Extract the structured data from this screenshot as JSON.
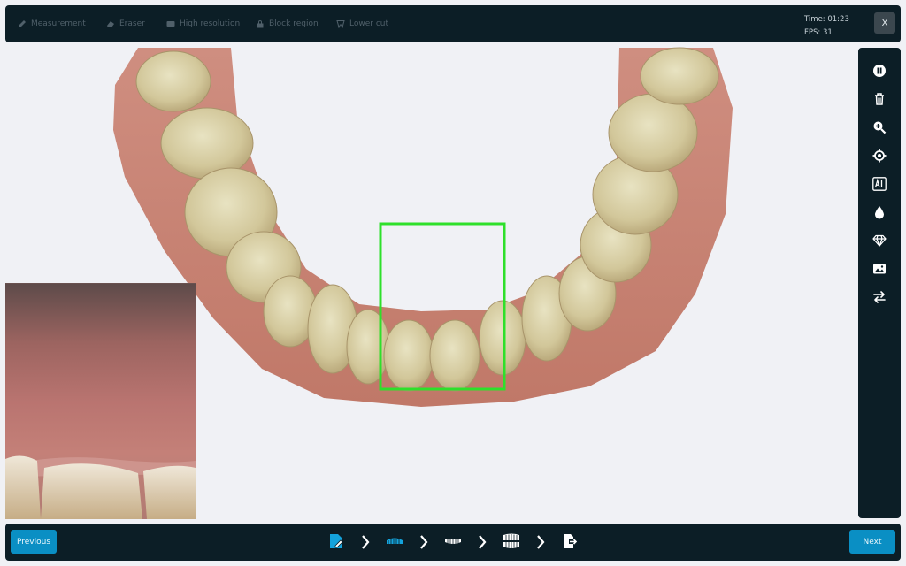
{
  "toolbar": {
    "tools": [
      {
        "label": "Measurement",
        "icon": "ruler-icon"
      },
      {
        "label": "Eraser",
        "icon": "eraser-icon"
      },
      {
        "label": "High resolution",
        "icon": "hd-icon"
      },
      {
        "label": "Block region",
        "icon": "lock-icon"
      },
      {
        "label": "Lower cut",
        "icon": "tooth-icon"
      }
    ],
    "time": "Time: 01:23",
    "fps": "FPS: 31",
    "close_label": "X"
  },
  "sidebar": {
    "icons": [
      "pause-icon",
      "trash-icon",
      "zoom-in-icon",
      "target-icon",
      "ai-icon",
      "drop-icon",
      "diamond-icon",
      "image-icon",
      "swap-icon"
    ]
  },
  "footer": {
    "previous_label": "Previous",
    "next_label": "Next",
    "steps": [
      "prescription-icon",
      "lower-arch-icon",
      "upper-arch-icon",
      "bite-icon",
      "export-icon"
    ],
    "active_step": 1
  },
  "colors": {
    "bar_bg": "#0c1e26",
    "accent": "#0a8fc4",
    "scan_box": "#2ee02a",
    "gum": "#c98678",
    "tooth": "#d9d2a6"
  }
}
